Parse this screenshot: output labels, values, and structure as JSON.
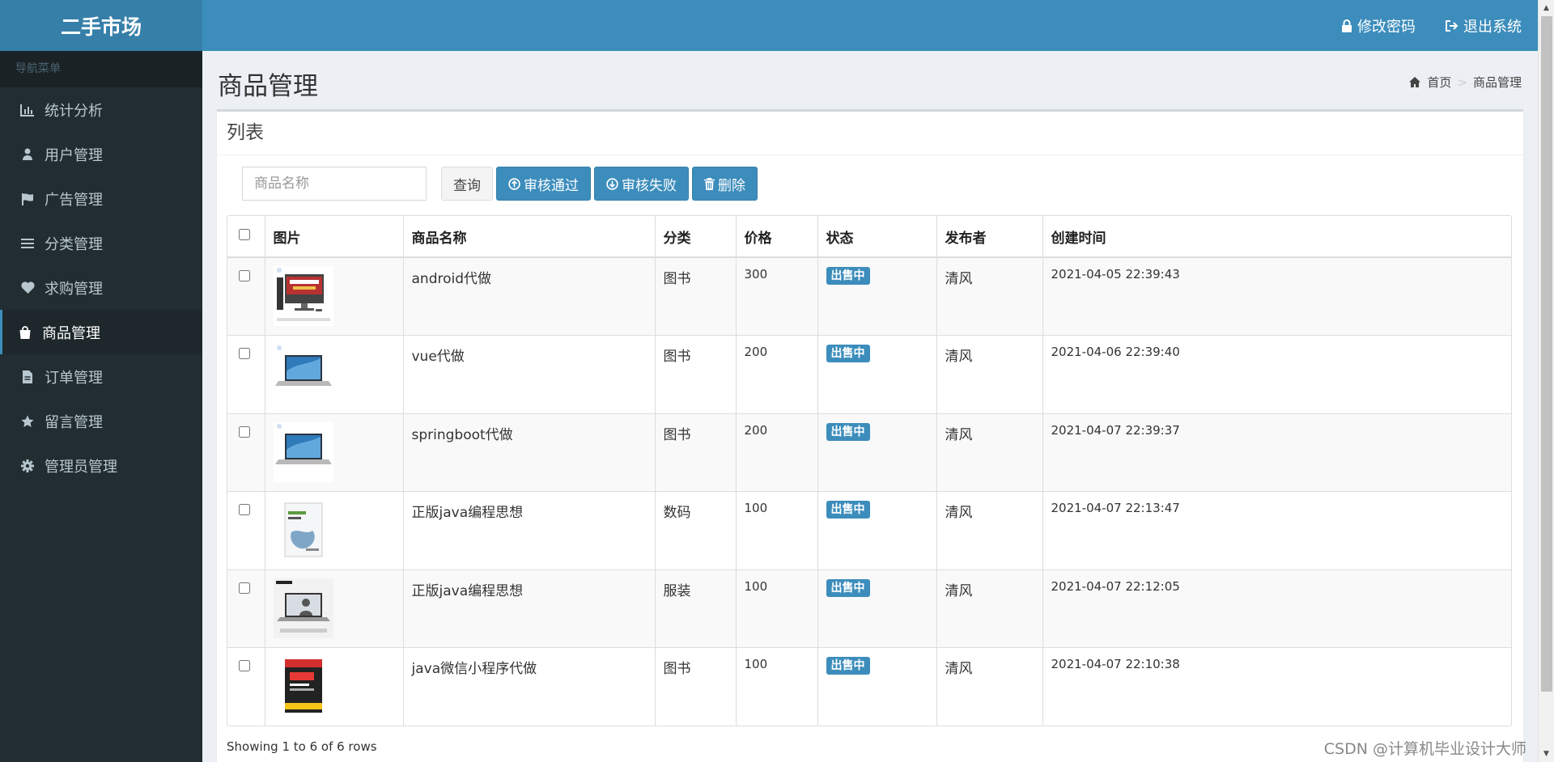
{
  "app": {
    "logo": "二手市场"
  },
  "topbar": {
    "change_password": "修改密码",
    "logout": "退出系统"
  },
  "sidebar": {
    "header": "导航菜单",
    "items": [
      {
        "label": "统计分析",
        "icon": "bar-chart-icon",
        "active": false
      },
      {
        "label": "用户管理",
        "icon": "user-icon",
        "active": false
      },
      {
        "label": "广告管理",
        "icon": "flag-icon",
        "active": false
      },
      {
        "label": "分类管理",
        "icon": "list-icon",
        "active": false
      },
      {
        "label": "求购管理",
        "icon": "heart-icon",
        "active": false
      },
      {
        "label": "商品管理",
        "icon": "shopping-bag-icon",
        "active": true
      },
      {
        "label": "订单管理",
        "icon": "file-icon",
        "active": false
      },
      {
        "label": "留言管理",
        "icon": "star-icon",
        "active": false
      },
      {
        "label": "管理员管理",
        "icon": "gear-icon",
        "active": false
      }
    ]
  },
  "page": {
    "title": "商品管理",
    "breadcrumb_home": "首页",
    "breadcrumb_separator": ">",
    "breadcrumb_current": "商品管理"
  },
  "box": {
    "title": "列表"
  },
  "toolbar": {
    "search_placeholder": "商品名称",
    "search_value": "",
    "query_label": "查询",
    "approve_label": "审核通过",
    "reject_label": "审核失败",
    "delete_label": "删除"
  },
  "table": {
    "columns": [
      "图片",
      "商品名称",
      "分类",
      "价格",
      "状态",
      "发布者",
      "创建时间"
    ],
    "rows": [
      {
        "thumb": "desktop-pc",
        "name": "android代做",
        "category": "图书",
        "price": "300",
        "status": "出售中",
        "publisher": "清风",
        "created": "2021-04-05 22:39:43"
      },
      {
        "thumb": "laptop-blue",
        "name": "vue代做",
        "category": "图书",
        "price": "200",
        "status": "出售中",
        "publisher": "清风",
        "created": "2021-04-06 22:39:40"
      },
      {
        "thumb": "laptop-blue",
        "name": "springboot代做",
        "category": "图书",
        "price": "200",
        "status": "出售中",
        "publisher": "清风",
        "created": "2021-04-07 22:39:37"
      },
      {
        "thumb": "book-springboot",
        "name": "正版java编程思想",
        "category": "数码",
        "price": "100",
        "status": "出售中",
        "publisher": "清风",
        "created": "2021-04-07 22:13:47"
      },
      {
        "thumb": "laptop-thinkbook",
        "name": "正版java编程思想",
        "category": "服装",
        "price": "100",
        "status": "出售中",
        "publisher": "清风",
        "created": "2021-04-07 22:12:05"
      },
      {
        "thumb": "book-java",
        "name": "java微信小程序代做",
        "category": "图书",
        "price": "100",
        "status": "出售中",
        "publisher": "清风",
        "created": "2021-04-07 22:10:38"
      }
    ]
  },
  "pager": {
    "summary": "Showing 1 to 6 of 6 rows"
  },
  "watermark": "CSDN @计算机毕业设计大师",
  "colors": {
    "accent": "#3c8dbc",
    "logo_bg": "#367fa9",
    "sidebar_bg": "#222d32",
    "content_bg": "#ecf0f5"
  }
}
